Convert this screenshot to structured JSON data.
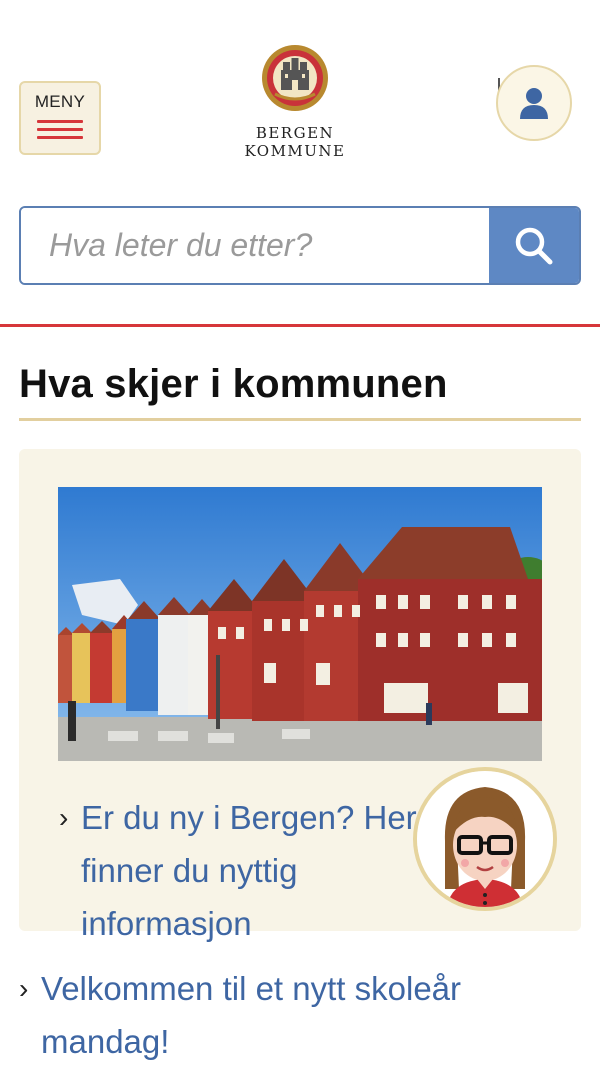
{
  "header": {
    "menu_label": "MENY",
    "brand_line1": "BERGEN",
    "brand_line2": "KOMMUNE",
    "icons": {
      "menu": "hamburger-icon",
      "user": "user-icon",
      "logo": "coat-of-arms-icon"
    }
  },
  "search": {
    "placeholder": "Hva leter du etter?",
    "icon": "search-icon"
  },
  "section": {
    "title": "Hva skjer i kommunen"
  },
  "featured": {
    "image_alt": "Bryggen i Bergen",
    "link_text": "Er du ny i Bergen? Her finner du nyttig informasjon",
    "chevron": "›"
  },
  "news": [
    {
      "chevron": "›",
      "text": "Velkommen til et nytt skoleår mandag!"
    }
  ],
  "colors": {
    "accent_red": "#d6363a",
    "accent_blue": "#5e88c4",
    "link_blue": "#3e66a3",
    "gold": "#e2cf9f",
    "cream": "#f8f4e7"
  }
}
